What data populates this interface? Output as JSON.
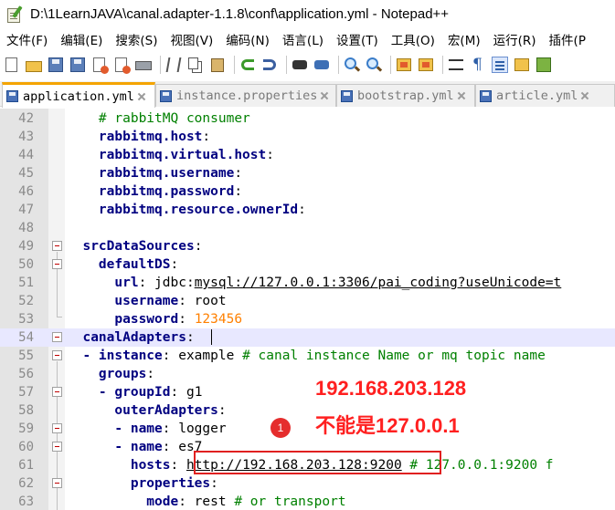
{
  "window": {
    "title": "D:\\1LearnJAVA\\canal.adapter-1.1.8\\conf\\application.yml - Notepad++"
  },
  "menu": [
    "文件(F)",
    "编辑(E)",
    "搜索(S)",
    "视图(V)",
    "编码(N)",
    "语言(L)",
    "设置(T)",
    "工具(O)",
    "宏(M)",
    "运行(R)",
    "插件(P"
  ],
  "toolbar": [
    "new-file-icon",
    "open-file-icon",
    "save-icon",
    "save-all-icon",
    "close-icon",
    "close-all-icon",
    "print-icon",
    "cut-icon",
    "copy-icon",
    "paste-icon",
    "undo-icon",
    "redo-icon",
    "find-icon",
    "replace-icon",
    "zoom-in-icon",
    "zoom-out-icon",
    "sync-v-icon",
    "sync-h-icon",
    "word-wrap-icon",
    "show-all-chars-icon",
    "indent-guide-icon",
    "function-list-icon",
    "macro-icon"
  ],
  "tabs": [
    {
      "label": "application.yml",
      "active": true
    },
    {
      "label": "instance.properties",
      "active": false
    },
    {
      "label": "bootstrap.yml",
      "active": false
    },
    {
      "label": "article.yml",
      "active": false
    }
  ],
  "lines": [
    {
      "num": "42",
      "parts": [
        [
          "c",
          "    # rabbitMQ consumer"
        ]
      ]
    },
    {
      "num": "43",
      "parts": [
        [
          "k",
          "    rabbitmq.host"
        ],
        [
          "p",
          ":"
        ]
      ]
    },
    {
      "num": "44",
      "parts": [
        [
          "k",
          "    rabbitmq.virtual.host"
        ],
        [
          "p",
          ":"
        ]
      ]
    },
    {
      "num": "45",
      "parts": [
        [
          "k",
          "    rabbitmq.username"
        ],
        [
          "p",
          ":"
        ]
      ]
    },
    {
      "num": "46",
      "parts": [
        [
          "k",
          "    rabbitmq.password"
        ],
        [
          "p",
          ":"
        ]
      ]
    },
    {
      "num": "47",
      "parts": [
        [
          "k",
          "    rabbitmq.resource.ownerId"
        ],
        [
          "p",
          ":"
        ]
      ]
    },
    {
      "num": "48",
      "parts": [
        [
          "p",
          ""
        ]
      ]
    },
    {
      "num": "49",
      "parts": [
        [
          "k",
          "  srcDataSources"
        ],
        [
          "p",
          ":"
        ]
      ]
    },
    {
      "num": "50",
      "parts": [
        [
          "k",
          "    defaultDS"
        ],
        [
          "p",
          ":"
        ]
      ]
    },
    {
      "num": "51",
      "parts": [
        [
          "k",
          "      url"
        ],
        [
          "p",
          ": jdbc:"
        ],
        [
          "u",
          "mysql://127.0.0.1:3306/pai_coding?useUnicode=t"
        ]
      ]
    },
    {
      "num": "52",
      "parts": [
        [
          "k",
          "      username"
        ],
        [
          "p",
          ": root"
        ]
      ]
    },
    {
      "num": "53",
      "parts": [
        [
          "k",
          "      password"
        ],
        [
          "p",
          ": "
        ],
        [
          "n",
          "123456"
        ]
      ]
    },
    {
      "num": "54",
      "parts": [
        [
          "k",
          "  canalAdapters"
        ],
        [
          "p",
          ":"
        ]
      ]
    },
    {
      "num": "55",
      "parts": [
        [
          "dash",
          "  - "
        ],
        [
          "k",
          "instance"
        ],
        [
          "p",
          ": example "
        ],
        [
          "c",
          "# canal instance Name or mq topic name"
        ]
      ]
    },
    {
      "num": "56",
      "parts": [
        [
          "k",
          "    groups"
        ],
        [
          "p",
          ":"
        ]
      ]
    },
    {
      "num": "57",
      "parts": [
        [
          "dash",
          "    - "
        ],
        [
          "k",
          "groupId"
        ],
        [
          "p",
          ": g1"
        ]
      ]
    },
    {
      "num": "58",
      "parts": [
        [
          "k",
          "      outerAdapters"
        ],
        [
          "p",
          ":"
        ]
      ]
    },
    {
      "num": "59",
      "parts": [
        [
          "dash",
          "      - "
        ],
        [
          "k",
          "name"
        ],
        [
          "p",
          ": logger"
        ]
      ]
    },
    {
      "num": "60",
      "parts": [
        [
          "dash",
          "      - "
        ],
        [
          "k",
          "name"
        ],
        [
          "p",
          ": es7"
        ]
      ]
    },
    {
      "num": "61",
      "parts": [
        [
          "k",
          "        hosts"
        ],
        [
          "p",
          ": "
        ],
        [
          "u",
          "http://192.168.203.128:9200"
        ],
        [
          "p",
          " "
        ],
        [
          "c",
          "# 127.0.0.1:9200 f"
        ]
      ]
    },
    {
      "num": "62",
      "parts": [
        [
          "k",
          "        properties"
        ],
        [
          "p",
          ":"
        ]
      ]
    },
    {
      "num": "63",
      "parts": [
        [
          "k",
          "          mode"
        ],
        [
          "p",
          ": rest "
        ],
        [
          "c",
          "# or transport"
        ]
      ]
    }
  ],
  "annotations": {
    "ip_text": "192.168.203.128",
    "note_text": "不能是127.0.0.1",
    "badge": "1",
    "accent_color": "#ff2020"
  }
}
